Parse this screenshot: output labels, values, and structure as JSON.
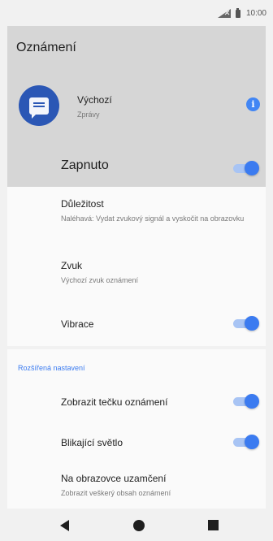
{
  "status_bar": {
    "time": "10:00",
    "icons": [
      "signal-icon",
      "battery-icon"
    ]
  },
  "header": {
    "title": "Oznámení",
    "app": {
      "name": "Výchozí",
      "subtitle": "Zprávy",
      "icon": "messages-icon"
    },
    "info_icon": "i",
    "master_toggle": {
      "label": "Zapnuto",
      "on": true
    }
  },
  "settings": {
    "importance": {
      "title": "Důležitost",
      "subtitle": "Naléhavá: Vydat zvukový signál a vyskočit na obrazovku"
    },
    "sound": {
      "title": "Zvuk",
      "subtitle": "Výchozí zvuk oznámení"
    },
    "vibration": {
      "title": "Vibrace",
      "on": true
    }
  },
  "advanced": {
    "header": "Rozšířená nastavení",
    "dot": {
      "title": "Zobrazit tečku oznámení",
      "on": true
    },
    "light": {
      "title": "Blikající světlo",
      "on": true
    },
    "lockscreen": {
      "title": "Na obrazovce uzamčení",
      "subtitle": "Zobrazit veškerý obsah oznámení"
    }
  },
  "nav": {
    "icons": [
      "back-icon",
      "home-icon",
      "recents-icon"
    ]
  },
  "colors": {
    "accent": "#3b7bf0",
    "header_bg": "#d6d6d6",
    "app_icon": "#2b57b5"
  }
}
